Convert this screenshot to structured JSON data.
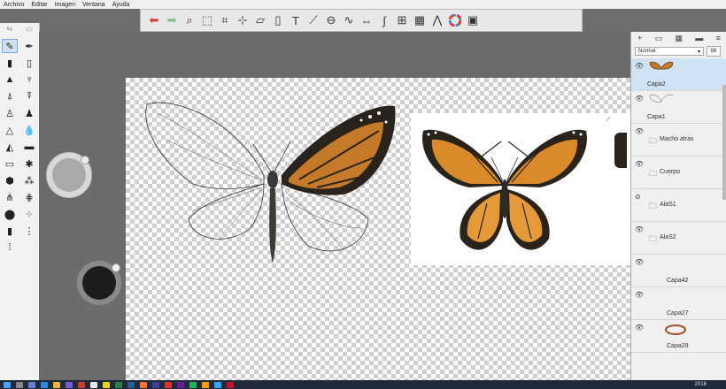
{
  "menu": [
    "Archivo",
    "Editar",
    "Imagen",
    "Ventana",
    "Ayuda"
  ],
  "toolbar": {
    "icons": [
      "undo-icon",
      "redo-icon",
      "zoom-icon",
      "select-icon",
      "crop-icon",
      "transform-icon",
      "distort-icon",
      "shape-icon",
      "text-icon",
      "ruler-icon",
      "ellipse-guide-icon",
      "french-curve-icon",
      "symmetry-icon",
      "curve-icon",
      "perspective-icon",
      "layer-icon",
      "brush-library-icon",
      "color-wheel-icon"
    ],
    "glyphs": [
      "←",
      "→",
      "🔍",
      "⬚",
      "⌗",
      "⊹",
      "⬡",
      "▱",
      "T",
      "📏",
      "⊖",
      "∿",
      "⇔",
      "∫",
      "⊞",
      "⊟",
      "⋀",
      "◎"
    ]
  },
  "layers_panel": {
    "blend_mode": "Normal",
    "opacity": "98",
    "layers": [
      {
        "name": "Capa2",
        "type": "layer",
        "active": true
      },
      {
        "name": "Capa1",
        "type": "layer",
        "active": false
      },
      {
        "name": "Macho atras",
        "type": "group",
        "active": false
      },
      {
        "name": "Cuerpo",
        "type": "group",
        "active": false
      },
      {
        "name": "AlaS1",
        "type": "group",
        "active": false
      },
      {
        "name": "AlaS2",
        "type": "group",
        "active": false
      },
      {
        "name": "Capa42",
        "type": "layer",
        "active": false
      },
      {
        "name": "Capa27",
        "type": "layer",
        "active": false
      },
      {
        "name": "Capa29",
        "type": "layer",
        "active": false
      }
    ]
  },
  "reference": {
    "male_symbol": "♂"
  },
  "taskbar": {
    "clock": "2016"
  },
  "colors": {
    "accent": "#cfe3f5",
    "orange": "#d98b2b",
    "wing_dark": "#2a231c"
  }
}
